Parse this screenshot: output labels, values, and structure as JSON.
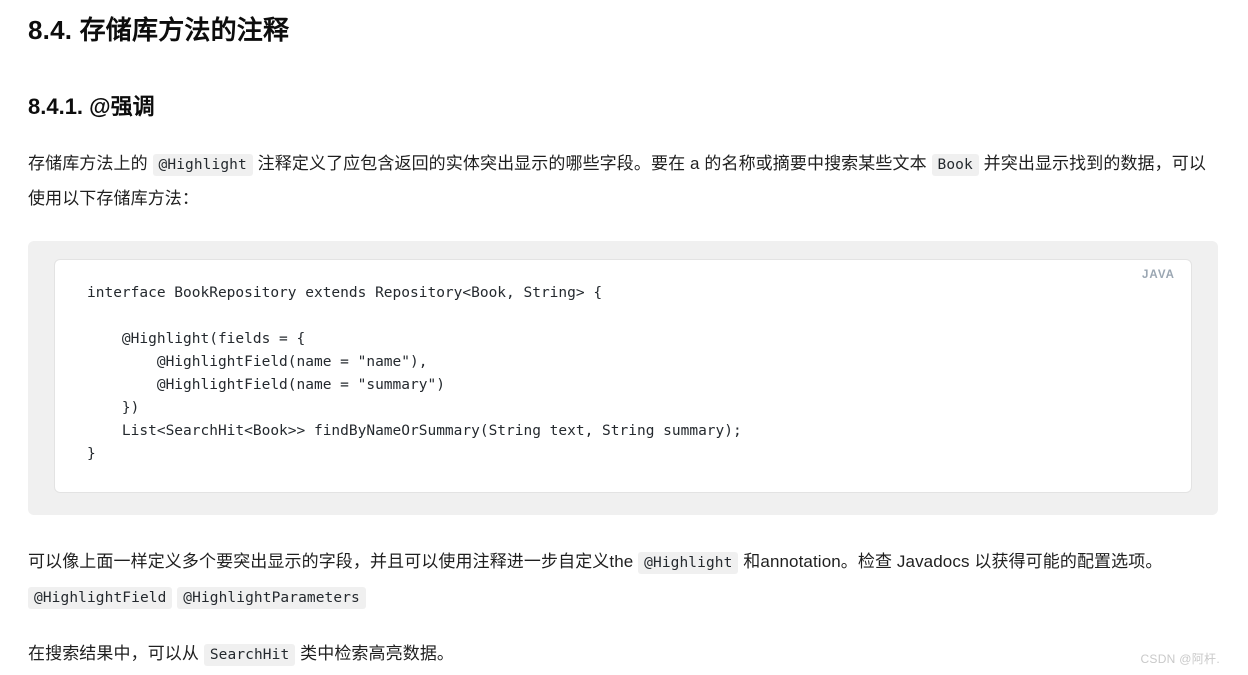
{
  "document": {
    "section_heading": "8.4. 存储库方法的注释",
    "subsection_heading": "8.4.1. @强调",
    "paragraph_1": {
      "part_1": "存储库方法上的 ",
      "code_1": "@Highlight",
      "part_2": " 注释定义了应包含返回的实体突出显示的哪些字段。要在 a 的名称或摘要中搜索某些文本 ",
      "code_2": "Book",
      "part_3": " 并突出显示找到的数据，可以使用以下存储库方法："
    },
    "code_block": {
      "language_label": "JAVA",
      "source": "interface BookRepository extends Repository<Book, String> {\n\n    @Highlight(fields = {\n        @HighlightField(name = \"name\"),\n        @HighlightField(name = \"summary\")\n    })\n    List<SearchHit<Book>> findByNameOrSummary(String text, String summary);\n}"
    },
    "paragraph_2": {
      "part_1": "可以像上面一样定义多个要突出显示的字段，并且可以使用注释进一步自定义the ",
      "code_1": "@Highlight",
      "part_2": " 和annotation。检查 Javadocs 以获得可能的配置选项。 ",
      "code_2": "@HighlightField",
      "part_3": " ",
      "code_3": "@HighlightParameters"
    },
    "paragraph_3": {
      "part_1": "在搜索结果中，可以从 ",
      "code_1": "SearchHit",
      "part_2": " 类中检索高亮数据。"
    },
    "watermark": "CSDN @阿杆."
  },
  "colors": {
    "text": "#1f1f1f",
    "heading": "#0d0d0d",
    "code_panel_bg": "#f0f0f0",
    "code_inner_bg": "#ffffff",
    "code_border": "#e3e3e3",
    "inline_code_bg": "#f0f0f0",
    "lang_label": "#9aa6b2",
    "watermark": "#c9c9c9"
  }
}
